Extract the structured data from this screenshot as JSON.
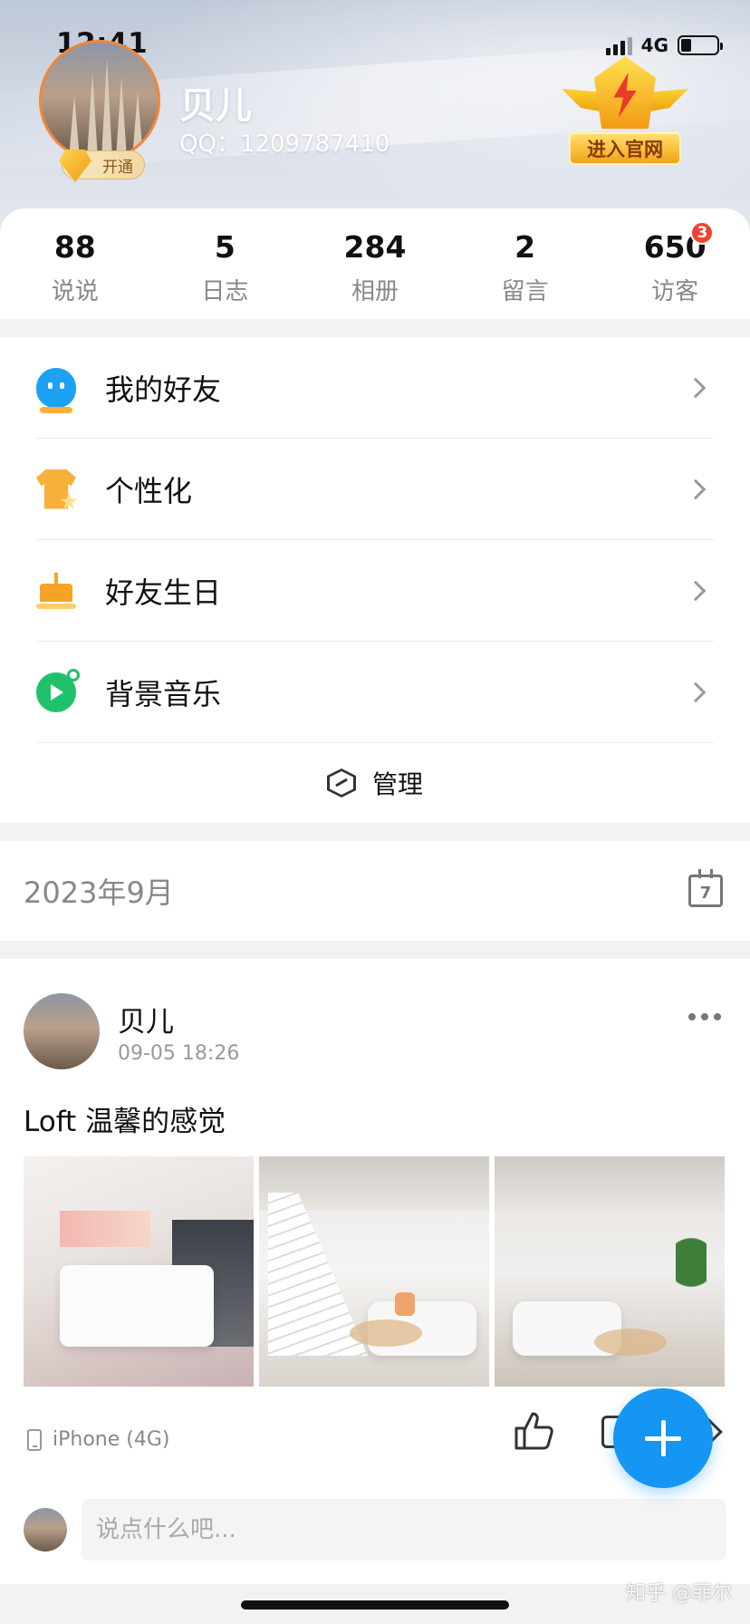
{
  "status_bar": {
    "time": "12:41",
    "network": "4G"
  },
  "profile": {
    "name": "贝儿",
    "qq": "QQ：1209787410",
    "open_badge": "开通",
    "official_label": "进入官网"
  },
  "stats": [
    {
      "value": "88",
      "label": "说说"
    },
    {
      "value": "5",
      "label": "日志"
    },
    {
      "value": "284",
      "label": "相册"
    },
    {
      "value": "2",
      "label": "留言"
    },
    {
      "value": "650",
      "label": "访客",
      "badge": "3"
    }
  ],
  "menu": {
    "items": [
      {
        "label": "我的好友",
        "icon": "friends-icon"
      },
      {
        "label": "个性化",
        "icon": "shirt-icon"
      },
      {
        "label": "好友生日",
        "icon": "cake-icon"
      },
      {
        "label": "背景音乐",
        "icon": "music-icon"
      }
    ],
    "manage_label": "管理"
  },
  "feed": {
    "date": "2023年9月",
    "calendar_day": "7"
  },
  "post": {
    "author": "贝儿",
    "time": "09-05 18:26",
    "text": "Loft 温馨的感觉",
    "device": "iPhone (4G)",
    "comment_placeholder": "说点什么吧..."
  },
  "watermark": "知乎 @菲尔",
  "colors": {
    "accent": "#1496f2",
    "badge_red": "#f2412d",
    "gold": "#f7b13a",
    "music_green": "#1fc26b"
  }
}
